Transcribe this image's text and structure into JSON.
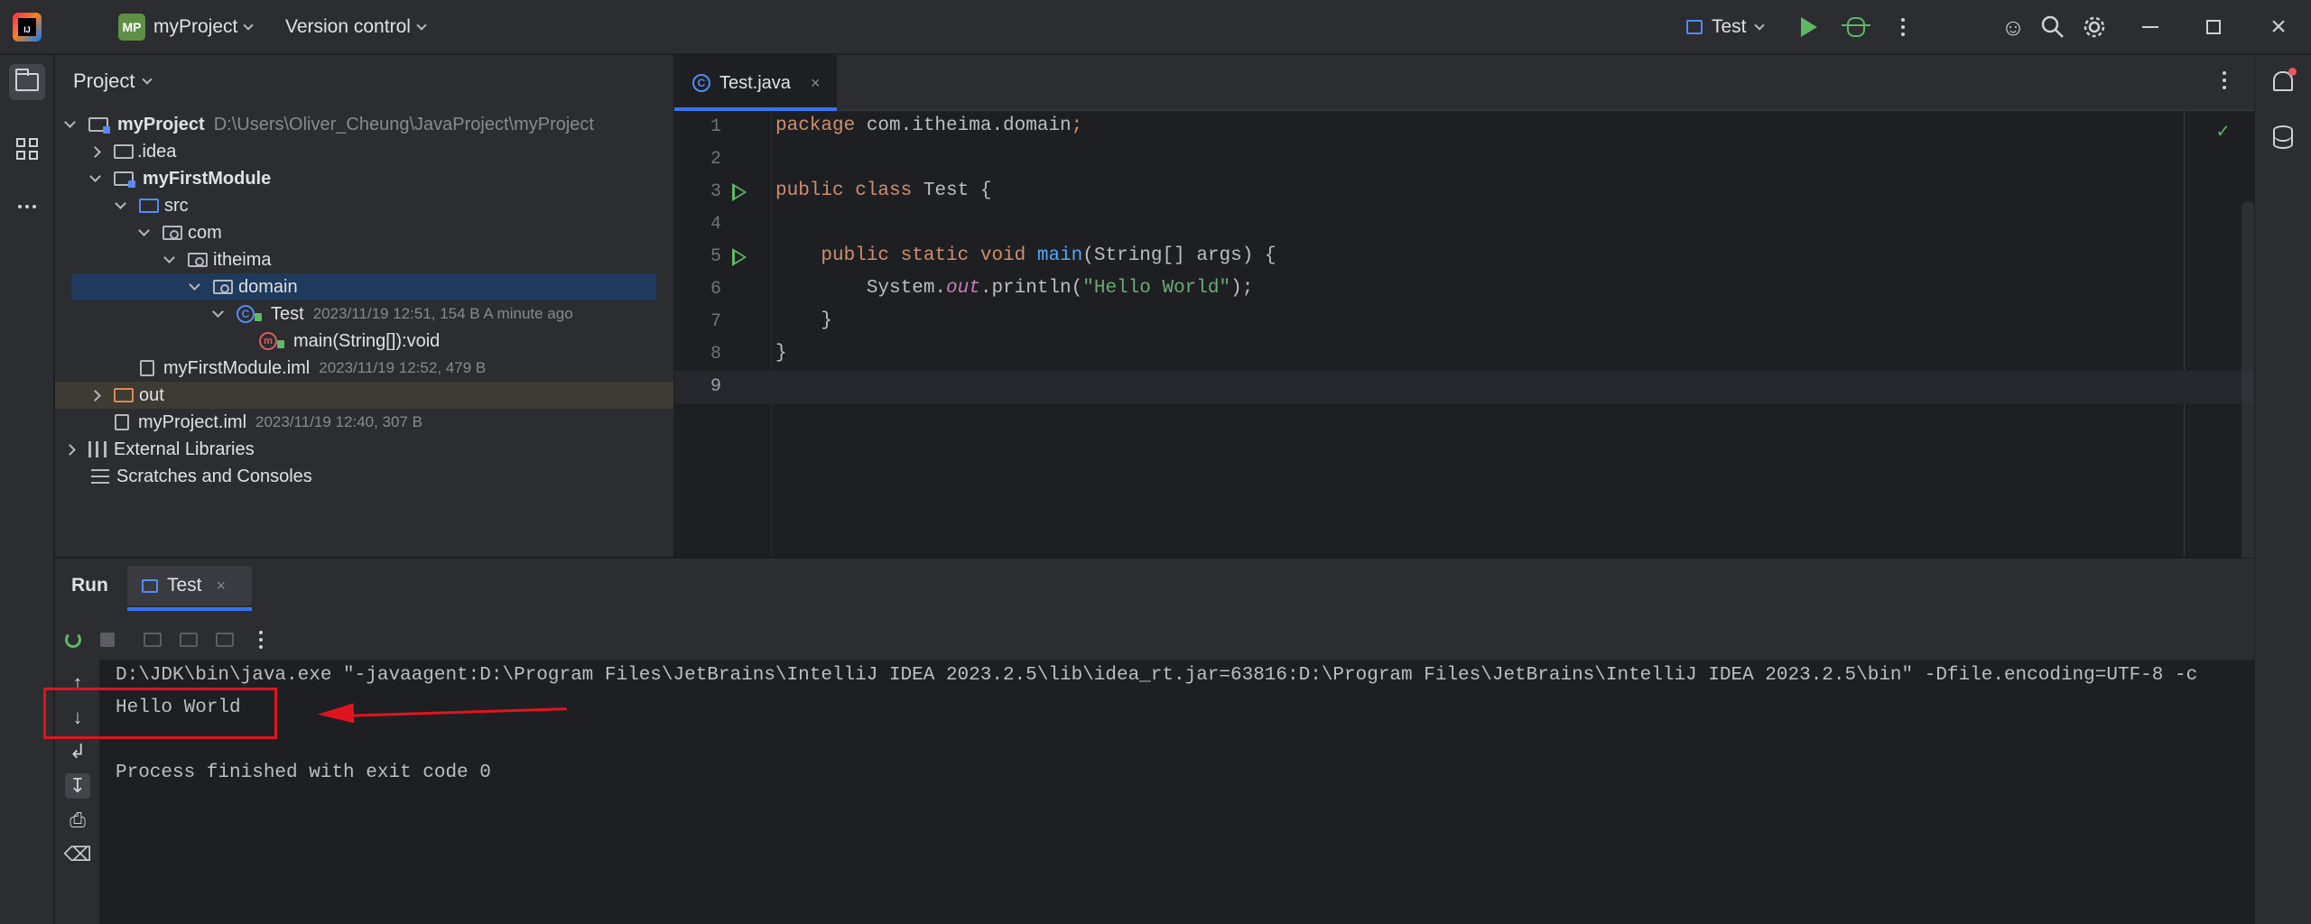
{
  "titlebar": {
    "project_badge": "MP",
    "project_name": "myProject",
    "version_control": "Version control",
    "run_config": "Test"
  },
  "project_panel": {
    "header": "Project",
    "tree": [
      {
        "label": "myProject",
        "meta": "D:\\Users\\Oliver_Cheung\\JavaProject\\myProject"
      },
      {
        "label": ".idea"
      },
      {
        "label": "myFirstModule"
      },
      {
        "label": "src"
      },
      {
        "label": "com"
      },
      {
        "label": "itheima"
      },
      {
        "label": "domain"
      },
      {
        "label": "Test",
        "meta": "2023/11/19 12:51, 154 B A minute ago"
      },
      {
        "label": "main(String[]):void"
      },
      {
        "label": "myFirstModule.iml",
        "meta": "2023/11/19 12:52, 479 B"
      },
      {
        "label": "out"
      },
      {
        "label": "myProject.iml",
        "meta": "2023/11/19 12:40, 307 B"
      },
      {
        "label": "External Libraries"
      },
      {
        "label": "Scratches and Consoles"
      }
    ]
  },
  "editor": {
    "tab_label": "Test.java",
    "line_numbers": [
      "1",
      "2",
      "3",
      "4",
      "5",
      "6",
      "7",
      "8",
      "9"
    ],
    "code": {
      "l1_kw": "package",
      "l1_pkg": " com.itheima.domain",
      "l1_semi": ";",
      "l3_kw": "public class",
      "l3_rest": " Test {",
      "l5_indent": "    ",
      "l5_kw": "public static void",
      "l5_sp": " ",
      "l5_fn": "main",
      "l5_rest": "(String[] args) {",
      "l6_a": "        System.",
      "l6_out": "out",
      "l6_b": ".println(",
      "l6_str": "\"Hello World\"",
      "l6_c": ");",
      "l7": "    }",
      "l8": "}"
    }
  },
  "run_panel": {
    "title": "Run",
    "tab_label": "Test",
    "console": [
      "D:\\JDK\\bin\\java.exe \"-javaagent:D:\\Program Files\\JetBrains\\IntelliJ IDEA 2023.2.5\\lib\\idea_rt.jar=63816:D:\\Program Files\\JetBrains\\IntelliJ IDEA 2023.2.5\\bin\" -Dfile.encoding=UTF-8 -c",
      "Hello World",
      "",
      "Process finished with exit code 0"
    ]
  },
  "colors": {
    "annotation_red": "#e0141e",
    "run_green": "#5fb865",
    "accent_blue": "#3574f0"
  }
}
